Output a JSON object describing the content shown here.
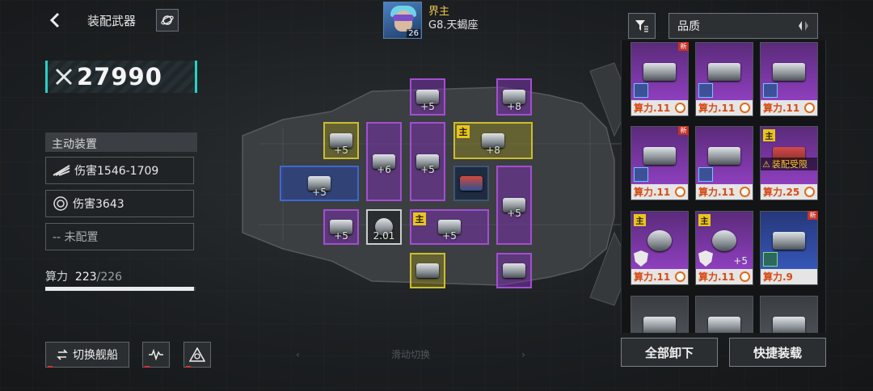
{
  "header": {
    "title": "装配武器",
    "player_name": "界主",
    "player_level": "26",
    "player_location": "G8.天蝎座"
  },
  "power": {
    "value": "27990"
  },
  "active_devices": {
    "title": "主动装置",
    "rows": [
      {
        "label": "伤害1546-1709"
      },
      {
        "label": "伤害3643"
      },
      {
        "label": "-- 未配置"
      }
    ]
  },
  "compute": {
    "label": "算力",
    "used": "223",
    "sep": "/",
    "max": "226",
    "fraction": 0.987
  },
  "buttons": {
    "switch_ship": "切换舰船",
    "unload_all": "全部卸下",
    "quick_equip": "快捷装载"
  },
  "slide_hint": "滑动切换",
  "slots": [
    {
      "plus": "+5"
    },
    {
      "plus": "+8"
    },
    {
      "plus": "+5"
    },
    {
      "plus": "+6"
    },
    {
      "plus": "+5"
    },
    {
      "plus": "+8",
      "main": "主"
    },
    {
      "plus": "+5"
    },
    {
      "plus": "+5"
    },
    {
      "plus": "+5"
    },
    {
      "value": "2.01"
    },
    {
      "plus": "+5",
      "main": "主"
    },
    {
      "plus": ""
    },
    {
      "plus": ""
    },
    {
      "plus": ""
    }
  ],
  "filter": {
    "quality_label": "品质"
  },
  "inventory": [
    {
      "label": "算力.11",
      "new": "新"
    },
    {
      "label": "算力.11"
    },
    {
      "label": "算力.11"
    },
    {
      "label": "算力.11",
      "new": "新"
    },
    {
      "label": "算力.11"
    },
    {
      "label": "算力.25",
      "main": "主",
      "warning": "装配受限"
    },
    {
      "label": "算力.11",
      "main": "主"
    },
    {
      "label": "算力.11",
      "main": "主",
      "plus": "+5"
    },
    {
      "label": "算力.9",
      "new": "新"
    }
  ],
  "colors": {
    "accent": "#27d1c5",
    "purple": "#a24fd1",
    "yellow": "#cbbe2f",
    "blue": "#3f68cf",
    "gold": "#f2c84b"
  }
}
